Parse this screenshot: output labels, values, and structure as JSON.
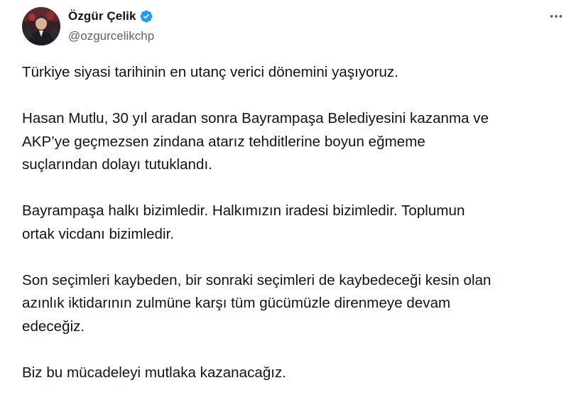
{
  "author": {
    "display_name": "Özgür Çelik",
    "handle": "@ozgurcelikchp",
    "verified": true,
    "verified_icon": "verified-badge-icon",
    "avatar": "profile-photo"
  },
  "menu_icon": "more-options-icon",
  "colors": {
    "text_primary": "#0f1419",
    "text_secondary": "#536471",
    "verified_blue": "#1d9bf0"
  },
  "tweet": {
    "paragraphs": [
      "Türkiye siyasi tarihinin en utanç verici dönemini yaşıyoruz.",
      "Hasan Mutlu, 30 yıl aradan sonra Bayrampaşa Belediyesini kazanma ve\nAKP’ye geçmezsen zindana atarız tehditlerine boyun eğmeme\nsuçlarından dolayı tutuklandı.",
      "Bayrampaşa halkı bizimledir. Halkımızın iradesi bizimledir. Toplumun\nortak vicdanı bizimledir.",
      "Son seçimleri kaybeden, bir sonraki seçimleri de kaybedeceği kesin olan\nazınlık iktidarının zulmüne karşı tüm gücümüzle direnmeye devam\nedeceğiz.",
      "Biz bu mücadeleyi mutlaka kazanacağız."
    ]
  }
}
